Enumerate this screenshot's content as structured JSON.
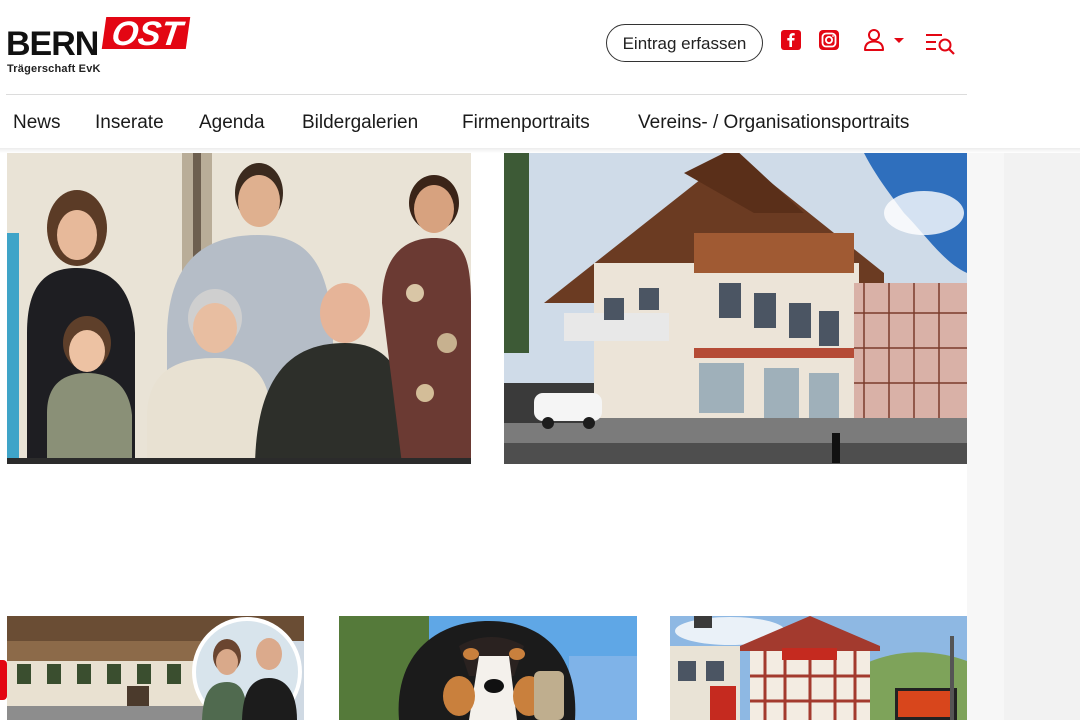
{
  "logo": {
    "part1": "BERN",
    "part2": "OST",
    "subtitle": "Trägerschaft EvK",
    "accent_color": "#e30613"
  },
  "header": {
    "entry_button_label": "Eintrag erfassen",
    "icons": [
      "facebook-icon",
      "instagram-icon",
      "user-icon",
      "search-list-icon"
    ]
  },
  "nav": {
    "items": [
      {
        "label": "News"
      },
      {
        "label": "Inserate"
      },
      {
        "label": "Agenda"
      },
      {
        "label": "Bildergalerien"
      },
      {
        "label": "Firmenportraits"
      },
      {
        "label": "Vereins- / Organisationsportraits"
      }
    ]
  },
  "cards": {
    "top": [
      {
        "image": "family-group-photo"
      },
      {
        "image": "swiss-chalet-building"
      }
    ],
    "bottom": [
      {
        "image": "restaurant-with-couple-portrait"
      },
      {
        "image": "bernese-mountain-dog"
      },
      {
        "image": "mcdrive-restaurant"
      }
    ]
  }
}
